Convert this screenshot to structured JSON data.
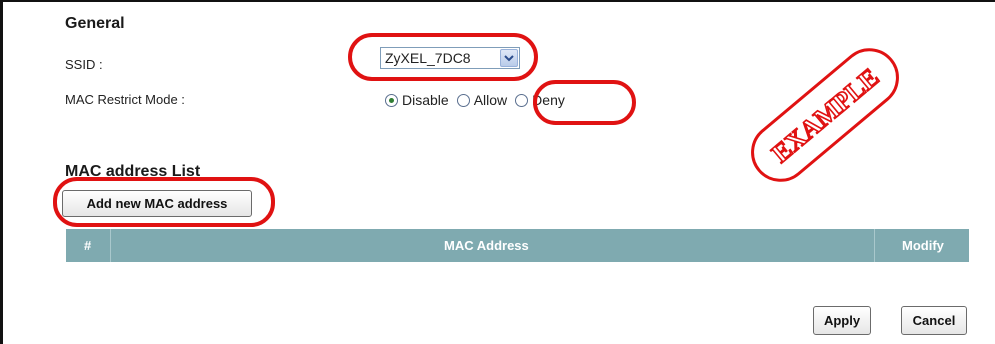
{
  "general": {
    "heading": "General",
    "ssid_label": "SSID :",
    "ssid_value": "ZyXEL_7DC8",
    "mac_restrict_label": "MAC Restrict Mode :",
    "mac_restrict_options": [
      "Disable",
      "Allow",
      "Deny"
    ],
    "mac_restrict_selected": "Disable"
  },
  "mac_list": {
    "heading": "MAC address List",
    "add_button": "Add new MAC address",
    "columns": [
      "#",
      "MAC Address",
      "Modify"
    ]
  },
  "actions": {
    "apply": "Apply",
    "cancel": "Cancel"
  },
  "stamp": {
    "text": "EXAMPLE"
  },
  "colors": {
    "table_header": "#7faab0",
    "highlight": "#e01212"
  }
}
